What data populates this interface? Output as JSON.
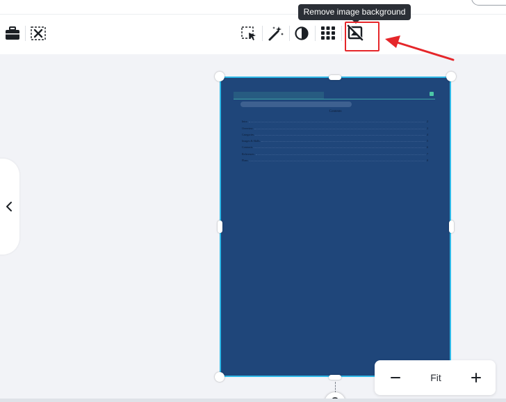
{
  "tooltip": {
    "text": "Remove image background"
  },
  "toolbar": {
    "left_icons": [
      "briefcase-icon",
      "crop-clear-icon"
    ],
    "right_icons": [
      "select-area-icon",
      "magic-wand-icon",
      "contrast-icon",
      "grid-dots-icon",
      "remove-background-icon"
    ]
  },
  "document": {
    "contents_title": "Contents",
    "toc": [
      {
        "label": "Intro",
        "page": "2"
      },
      {
        "label": "Overview",
        "page": "3"
      },
      {
        "label": "Categories",
        "page": "4"
      },
      {
        "label": "Images & Skills",
        "page": "5"
      },
      {
        "label": "Contracts",
        "page": "6"
      },
      {
        "label": "References",
        "page": "7"
      },
      {
        "label": "Plans",
        "page": "8"
      }
    ]
  },
  "zoom": {
    "label": "Fit",
    "minus": "−",
    "plus": "+"
  },
  "colors": {
    "canvas_bg": "#1f467a",
    "selection": "#2fb9e8",
    "annotation": "#e5262a",
    "tooltip_bg": "#2b2f36"
  }
}
